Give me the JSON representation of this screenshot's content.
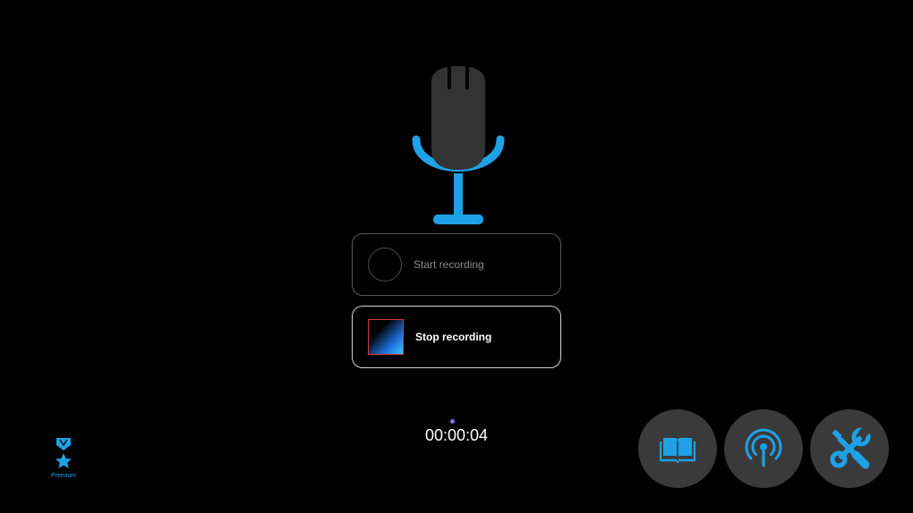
{
  "colors": {
    "accent": "#1ea1e6",
    "background": "#000000",
    "button_circle": "#3a3a3a",
    "mic_body": "#333333"
  },
  "icons": {
    "microphone": "microphone-icon",
    "start": "record-circle-icon",
    "stop": "stop-square-icon",
    "premium": "medal-star-icon",
    "book": "open-book-icon",
    "broadcast": "broadcast-icon",
    "tools": "wrench-screwdriver-icon"
  },
  "controls": {
    "start_label": "Start recording",
    "stop_label": "Stop recording"
  },
  "timer": {
    "elapsed": "00:00:04"
  },
  "premium": {
    "label": "Premium"
  }
}
